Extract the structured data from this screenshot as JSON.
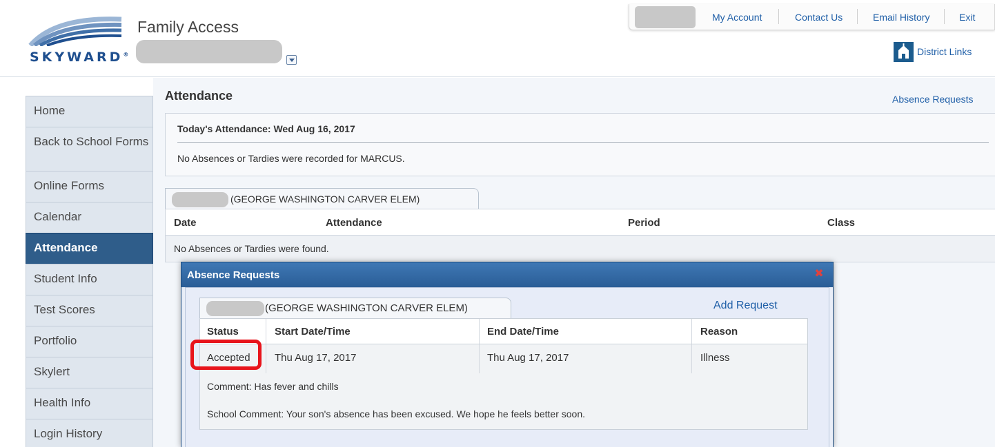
{
  "header": {
    "brand": "SKYWARD",
    "app_title": "Family Access",
    "district_links_label": "District Links"
  },
  "topnav": {
    "items": [
      "My Account",
      "Contact Us",
      "Email History",
      "Exit"
    ]
  },
  "sidebar": {
    "items": [
      {
        "label": "Home"
      },
      {
        "label": "Back to School Forms"
      },
      {
        "label": "Online Forms"
      },
      {
        "label": "Calendar"
      },
      {
        "label": "Attendance",
        "active": true
      },
      {
        "label": "Student Info"
      },
      {
        "label": "Test Scores"
      },
      {
        "label": "Portfolio"
      },
      {
        "label": "Skylert"
      },
      {
        "label": "Health Info"
      },
      {
        "label": "Login History"
      }
    ]
  },
  "main": {
    "title": "Attendance",
    "absence_requests_link": "Absence Requests",
    "today": {
      "title": "Today's Attendance: Wed Aug 16, 2017",
      "message": "No Absences or Tardies were recorded for MARCUS."
    },
    "school_tab": "(GEORGE WASHINGTON CARVER ELEM)",
    "table": {
      "headers": [
        "Date",
        "Attendance",
        "Period",
        "Class"
      ],
      "empty_message": "No Absences or Tardies were found."
    }
  },
  "modal": {
    "title": "Absence Requests",
    "school_tab": "(GEORGE WASHINGTON CARVER ELEM)",
    "add_request": "Add Request",
    "headers": [
      "Status",
      "Start Date/Time",
      "End Date/Time",
      "Reason"
    ],
    "row": {
      "status": "Accepted",
      "start": "Thu Aug 17, 2017",
      "end": "Thu Aug 17, 2017",
      "reason": "Illness"
    },
    "comment": "Comment: Has fever and chills",
    "school_comment": "School Comment: Your son's absence has been excused. We hope he feels better soon."
  },
  "colors": {
    "accent": "#2160a8",
    "nav_active": "#2f5d8a",
    "modal_bar": "#2a5d96",
    "highlight": "#e8141b"
  }
}
